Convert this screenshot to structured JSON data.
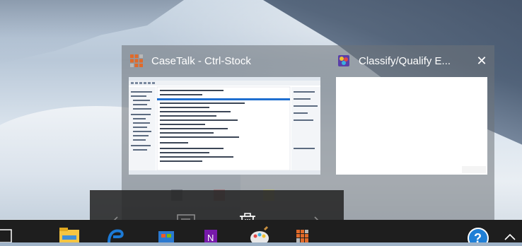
{
  "switcher": {
    "windows": [
      {
        "title": "CaseTalk - Ctrl-Stock",
        "icon": "casetalk-app-icon"
      },
      {
        "title": "Classify/Qualify E...",
        "icon": "classify-app-icon"
      }
    ],
    "close_label": "✕"
  },
  "command_bar": {
    "items": [
      {
        "name": "previous-arrow-icon"
      },
      {
        "name": "view-button-icon"
      },
      {
        "name": "delete-trash-icon"
      },
      {
        "name": "next-arrow-icon"
      }
    ]
  },
  "taskbar": {
    "items": [
      "task-view-icon",
      "file-explorer-icon",
      "edge-icon",
      "store-icon",
      "onenote-icon",
      "paint-icon",
      "casetalk-icon",
      "help-icon",
      "show-hidden-icons-chevron"
    ]
  },
  "colors": {
    "accent": "#76b9ed",
    "switcher_bg": "#6e7278",
    "taskbar_bg": "#1e1e1e"
  }
}
